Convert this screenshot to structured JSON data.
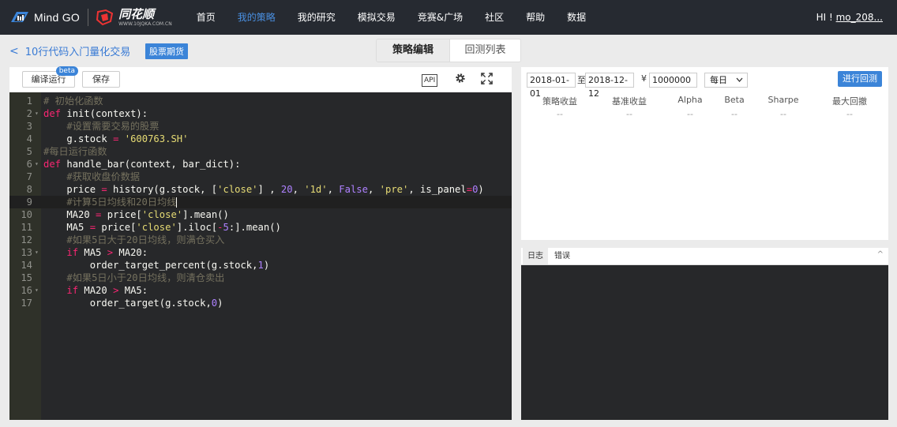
{
  "nav": {
    "brand": "Mind GO",
    "partner": "同花顺",
    "partner_sub": "WWW.10JQKA.COM.CN",
    "items": [
      "首页",
      "我的策略",
      "我的研究",
      "模拟交易",
      "竞赛&广场",
      "社区",
      "帮助",
      "数据"
    ],
    "active_index": 1,
    "greeting": "HI ! ",
    "username": "mo_208..."
  },
  "subheader": {
    "back_arrow": "<",
    "title": "10行代码入门量化交易",
    "tag": "股票期货",
    "tabs": [
      "策略编辑",
      "回测列表"
    ],
    "active_tab": 0
  },
  "toolbar": {
    "compile_label": "编译运行",
    "compile_badge": "beta",
    "save_label": "保存",
    "api_label": "API",
    "gear_icon": "gear-icon",
    "fullscreen_icon": "fullscreen-icon"
  },
  "editor": {
    "current_line": 9,
    "lines": [
      [
        [
          "c",
          "# 初始化函数"
        ]
      ],
      [
        [
          "k",
          "def"
        ],
        [
          "f",
          " init(context):"
        ]
      ],
      [
        [
          "f",
          "    "
        ],
        [
          "c",
          "#设置需要交易的股票"
        ]
      ],
      [
        [
          "f",
          "    g.stock "
        ],
        [
          "k",
          "="
        ],
        [
          "f",
          " "
        ],
        [
          "s",
          "'600763.SH'"
        ]
      ],
      [
        [
          "c",
          "#每日运行函数"
        ]
      ],
      [
        [
          "k",
          "def"
        ],
        [
          "f",
          " handle_bar(context, bar_dict):"
        ]
      ],
      [
        [
          "f",
          "    "
        ],
        [
          "c",
          "#获取收盘价数据"
        ]
      ],
      [
        [
          "f",
          "    price "
        ],
        [
          "k",
          "="
        ],
        [
          "f",
          " history(g.stock, ["
        ],
        [
          "s",
          "'close'"
        ],
        [
          "f",
          "] , "
        ],
        [
          "n",
          "20"
        ],
        [
          "f",
          ", "
        ],
        [
          "s",
          "'1d'"
        ],
        [
          "f",
          ", "
        ],
        [
          "n",
          "False"
        ],
        [
          "f",
          ", "
        ],
        [
          "s",
          "'pre'"
        ],
        [
          "f",
          ", is_panel"
        ],
        [
          "k",
          "="
        ],
        [
          "n",
          "0"
        ],
        [
          "f",
          ")"
        ]
      ],
      [
        [
          "f",
          "    "
        ],
        [
          "c",
          "#计算5日均线和20日均线"
        ]
      ],
      [
        [
          "f",
          "    MA20 "
        ],
        [
          "k",
          "="
        ],
        [
          "f",
          " price["
        ],
        [
          "s",
          "'close'"
        ],
        [
          "f",
          "].mean()"
        ]
      ],
      [
        [
          "f",
          "    MA5 "
        ],
        [
          "k",
          "="
        ],
        [
          "f",
          " price["
        ],
        [
          "s",
          "'close'"
        ],
        [
          "f",
          "].iloc["
        ],
        [
          "k",
          "-"
        ],
        [
          "n",
          "5"
        ],
        [
          "f",
          ":].mean()"
        ]
      ],
      [
        [
          "f",
          "    "
        ],
        [
          "c",
          "#如果5日大于20日均线，则满仓买入"
        ]
      ],
      [
        [
          "f",
          "    "
        ],
        [
          "k",
          "if"
        ],
        [
          "f",
          " MA5 "
        ],
        [
          "k",
          ">"
        ],
        [
          "f",
          " MA20:"
        ]
      ],
      [
        [
          "f",
          "        order_target_percent(g.stock,"
        ],
        [
          "n",
          "1"
        ],
        [
          "f",
          ")"
        ]
      ],
      [
        [
          "f",
          "    "
        ],
        [
          "c",
          "#如果5日小于20日均线，则清仓卖出"
        ]
      ],
      [
        [
          "f",
          "    "
        ],
        [
          "k",
          "if"
        ],
        [
          "f",
          " MA20 "
        ],
        [
          "k",
          ">"
        ],
        [
          "f",
          " MA5:"
        ]
      ],
      [
        [
          "f",
          "        order_target(g.stock,"
        ],
        [
          "n",
          "0"
        ],
        [
          "f",
          ")"
        ]
      ]
    ],
    "fold_lines": [
      2,
      6,
      13,
      16
    ],
    "colors": {
      "bg": "#27282a",
      "comment": "#75715e",
      "keyword": "#f92672",
      "string": "#e6db74",
      "number": "#ae81ff"
    }
  },
  "backtest": {
    "start_date": "2018-01-01",
    "to_label": "至",
    "end_date": "2018-12-12",
    "currency_symbol": "¥",
    "capital": "1000000",
    "frequency": "每日",
    "run_label": "进行回测",
    "metric_headers": [
      "策略收益",
      "基准收益",
      "Alpha",
      "Beta",
      "Sharpe",
      "最大回撤"
    ],
    "metric_values": [
      "--",
      "--",
      "--",
      "--",
      "--",
      "--"
    ]
  },
  "log": {
    "tabs": [
      "日志",
      "错误"
    ],
    "active_tab": 0,
    "collapse_icon": "^"
  }
}
